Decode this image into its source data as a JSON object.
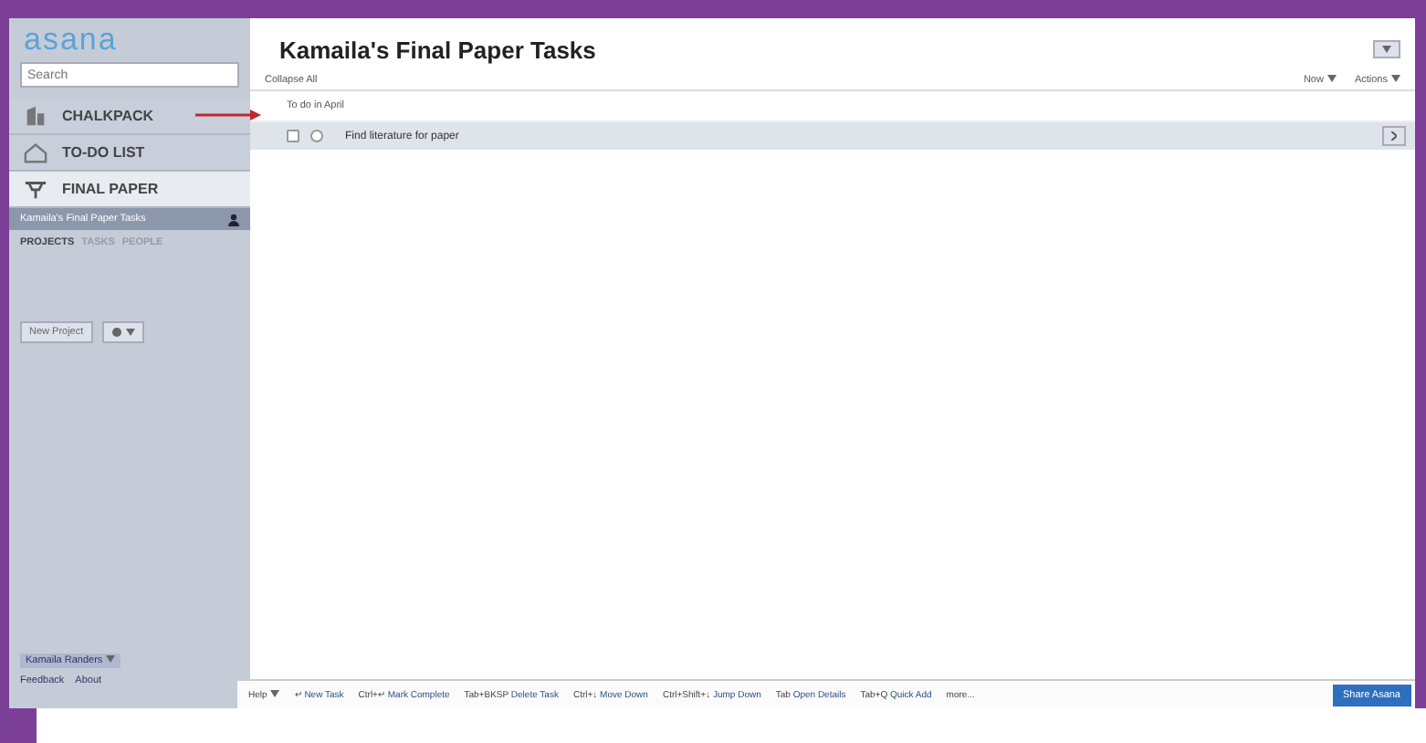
{
  "sidebar": {
    "logo": "asana",
    "search": {
      "placeholder": "Search"
    },
    "nav": [
      {
        "label": "CHALKPACK",
        "selected": false
      },
      {
        "label": "TO-DO LIST",
        "selected": false
      },
      {
        "label": "FINAL PAPER",
        "selected": true
      }
    ],
    "workspace": "Kamaila's Final Paper Tasks",
    "tabs": [
      {
        "label": "PROJECTS",
        "selected": true
      },
      {
        "label": "TASKS",
        "selected": false
      },
      {
        "label": "PEOPLE",
        "selected": false
      }
    ],
    "new_project": "New Project",
    "user": "Kamaila Randers",
    "links": [
      "Feedback",
      "About"
    ]
  },
  "main": {
    "title": "Kamaila's Final Paper Tasks",
    "collapse": "Collapse All",
    "view": "Now",
    "actions": "Actions",
    "section": "To do in April",
    "tasks": [
      {
        "name": "Find literature for paper",
        "selected": true,
        "checked": false
      }
    ]
  },
  "footer": {
    "help": "Help",
    "shortcuts": [
      {
        "key": "↵",
        "action": "New Task"
      },
      {
        "key": "Ctrl+↵",
        "action": "Mark Complete"
      },
      {
        "key": "Tab+BKSP",
        "action": "Delete Task"
      },
      {
        "key": "Ctrl+↓",
        "action": "Move Down"
      },
      {
        "key": "Ctrl+Shift+↓",
        "action": "Jump Down"
      },
      {
        "key": "Tab",
        "action": "Open Details"
      },
      {
        "key": "Tab+Q",
        "action": "Quick Add"
      }
    ],
    "more": "more...",
    "share": "Share Asana"
  }
}
